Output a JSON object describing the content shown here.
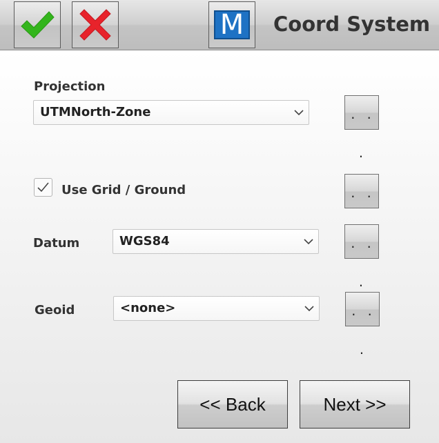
{
  "header": {
    "title": "Coord System",
    "accept_icon": "checkmark-icon",
    "cancel_icon": "x-icon",
    "logo_icon": "m-logo-icon",
    "logo_letter": "M"
  },
  "projection": {
    "label": "Projection",
    "value": "UTMNorth-Zone",
    "more_label": ". . ."
  },
  "grid_ground": {
    "label": "Use Grid / Ground",
    "checked": true,
    "more_label": ". . ."
  },
  "datum": {
    "label": "Datum",
    "value": "WGS84",
    "more_label": ". . ."
  },
  "geoid": {
    "label": "Geoid",
    "value": "<none>",
    "more_label": ". . ."
  },
  "navigation": {
    "back_label": "<< Back",
    "next_label": "Next >>"
  },
  "colors": {
    "check_green": "#33b51c",
    "cancel_red": "#e8232b",
    "logo_blue": "#1e72c4"
  }
}
